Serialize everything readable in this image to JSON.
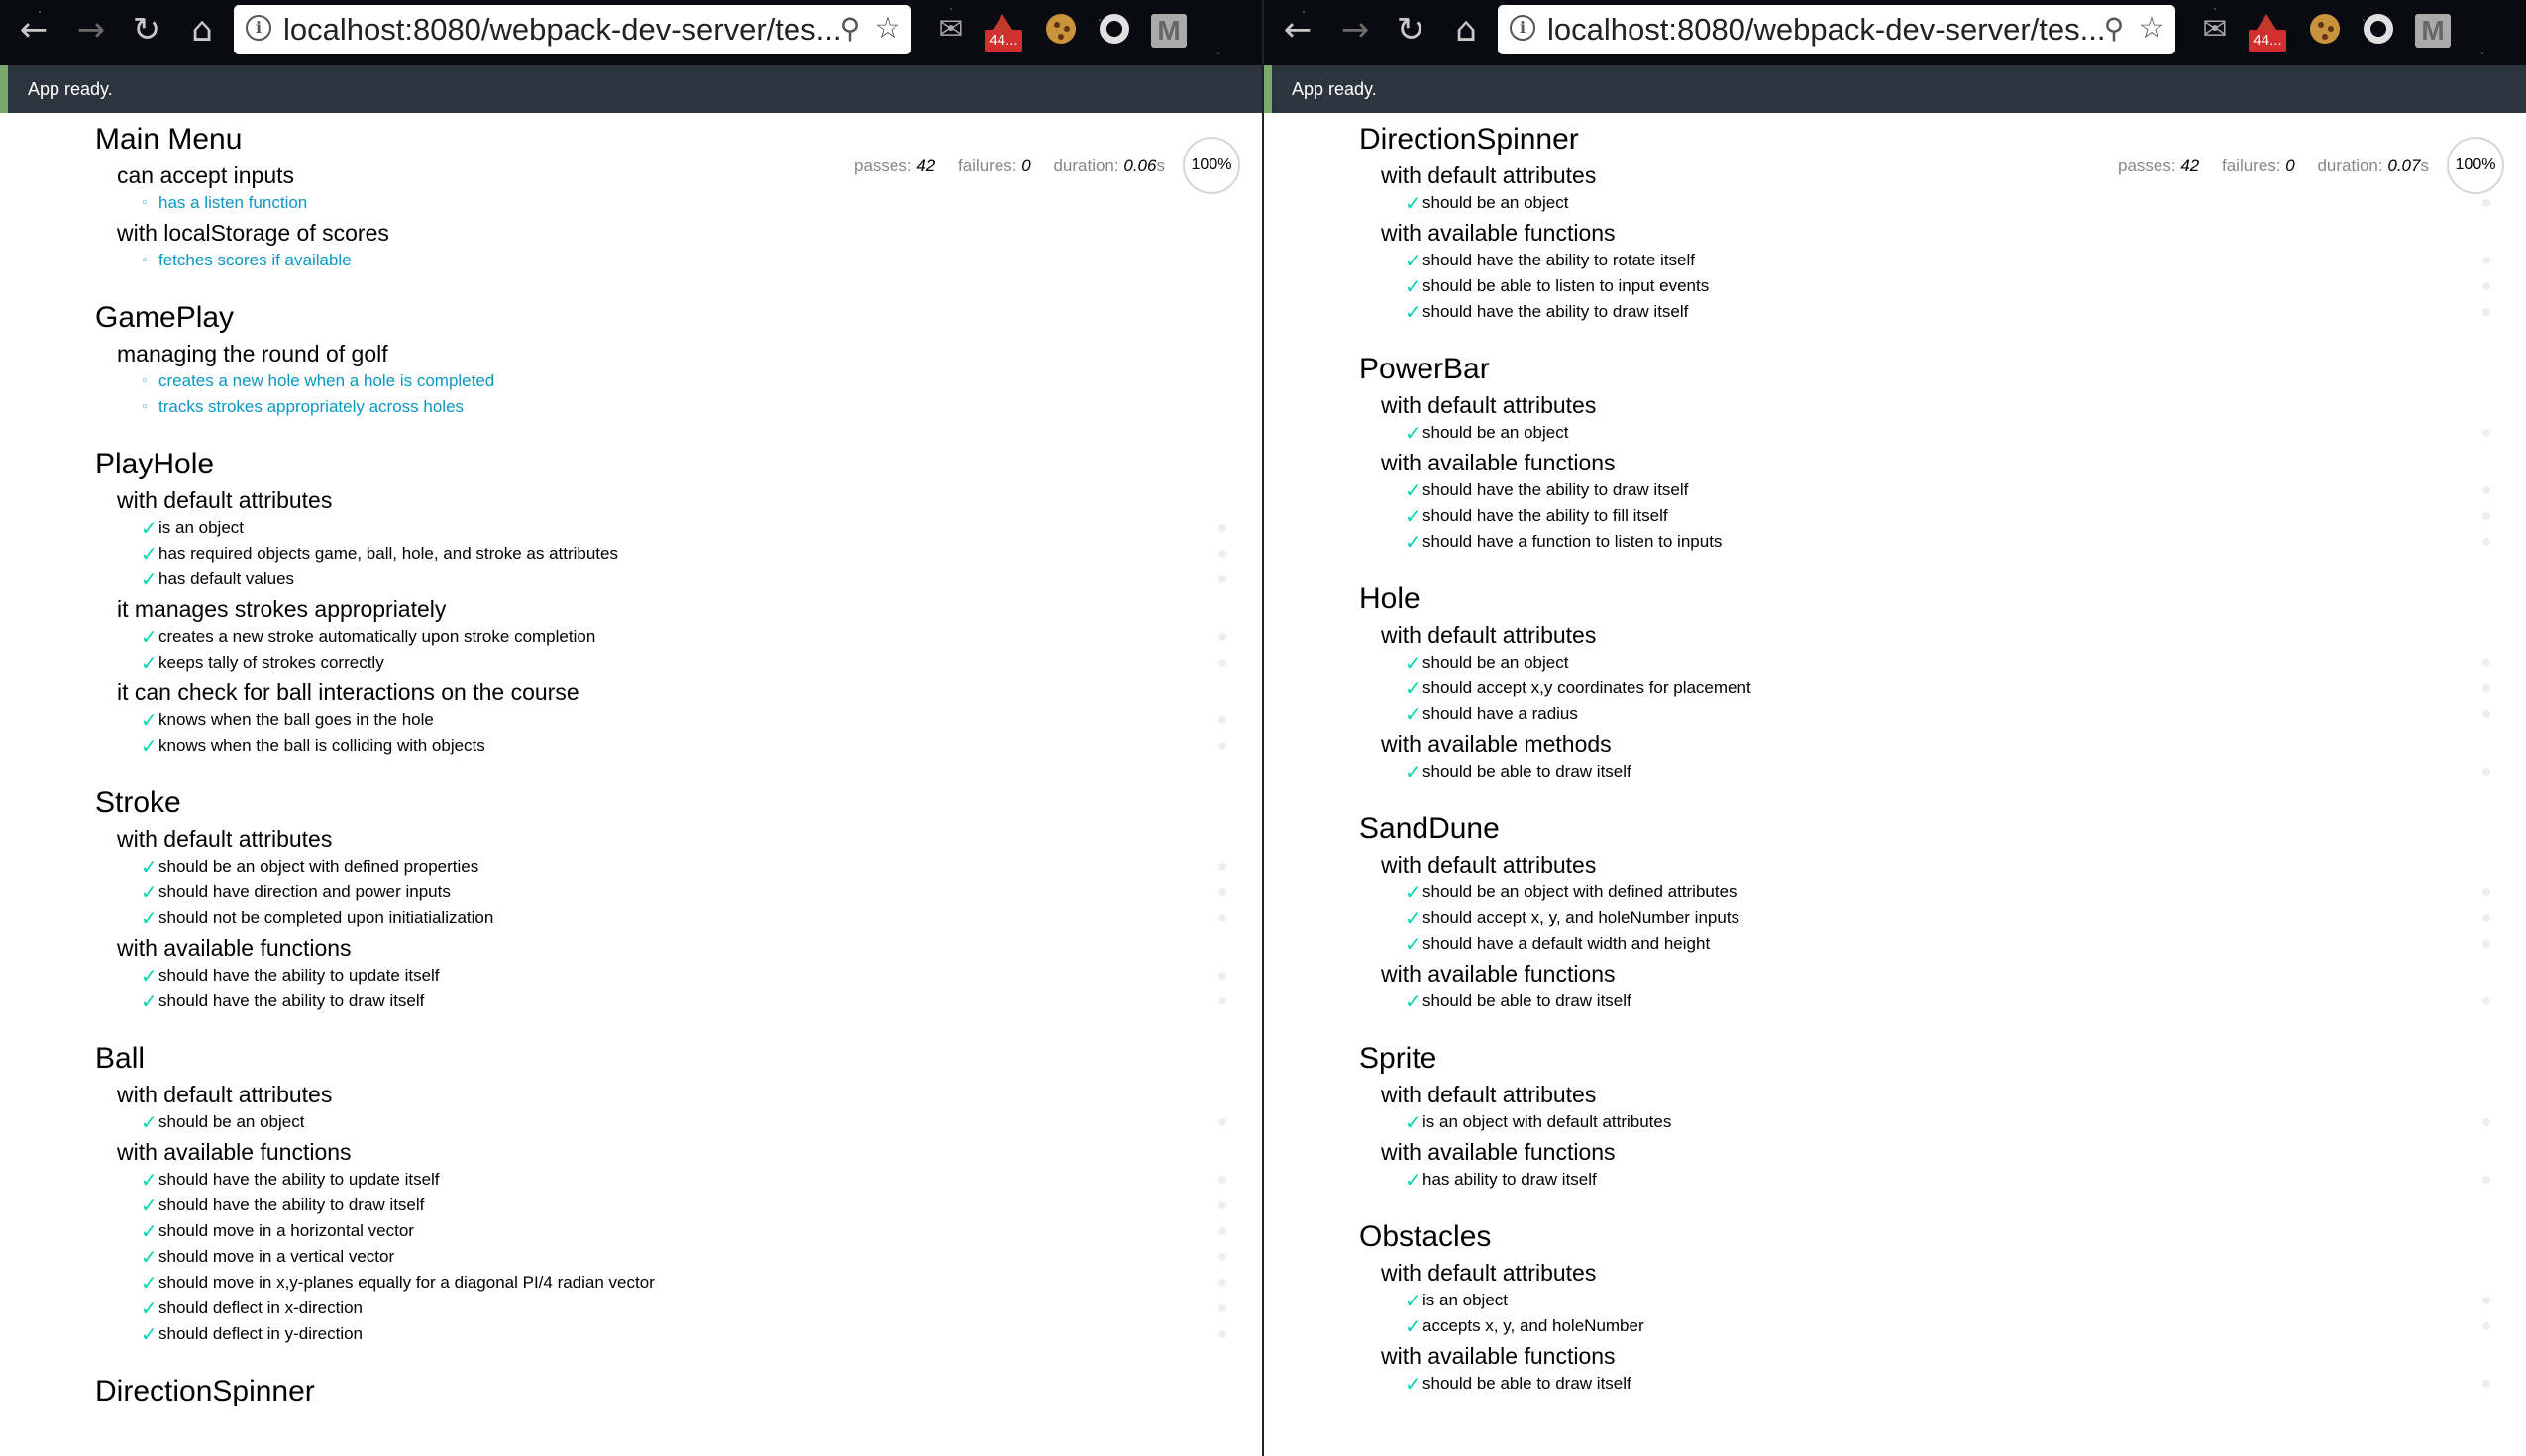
{
  "panes": [
    {
      "url": "localhost:8080/webpack-dev-server/tes...",
      "badge": "44...",
      "status": "App ready.",
      "stats": {
        "passes_label": "passes:",
        "passes": "42",
        "failures_label": "failures:",
        "failures": "0",
        "duration_label": "duration:",
        "duration": "0.06",
        "duration_unit": "s",
        "progress": "100%"
      },
      "suites": [
        {
          "title": "Main Menu",
          "groups": [
            {
              "title": "can accept inputs",
              "tests": [
                {
                  "label": "has a listen function",
                  "state": "pending"
                }
              ]
            },
            {
              "title": "with localStorage of scores",
              "tests": [
                {
                  "label": "fetches scores if available",
                  "state": "pending"
                }
              ]
            }
          ]
        },
        {
          "title": "GamePlay",
          "groups": [
            {
              "title": "managing the round of golf",
              "tests": [
                {
                  "label": "creates a new hole when a hole is completed",
                  "state": "pending"
                },
                {
                  "label": "tracks strokes appropriately across holes",
                  "state": "pending"
                }
              ]
            }
          ]
        },
        {
          "title": "PlayHole",
          "groups": [
            {
              "title": "with default attributes",
              "tests": [
                {
                  "label": "is an object",
                  "state": "pass"
                },
                {
                  "label": "has required objects game, ball, hole, and stroke as attributes",
                  "state": "pass"
                },
                {
                  "label": "has default values",
                  "state": "pass"
                }
              ]
            },
            {
              "title": "it manages strokes appropriately",
              "tests": [
                {
                  "label": "creates a new stroke automatically upon stroke completion",
                  "state": "pass"
                },
                {
                  "label": "keeps tally of strokes correctly",
                  "state": "pass"
                }
              ]
            },
            {
              "title": "it can check for ball interactions on the course",
              "tests": [
                {
                  "label": "knows when the ball goes in the hole",
                  "state": "pass"
                },
                {
                  "label": "knows when the ball is colliding with objects",
                  "state": "pass"
                }
              ]
            }
          ]
        },
        {
          "title": "Stroke",
          "groups": [
            {
              "title": "with default attributes",
              "tests": [
                {
                  "label": "should be an object with defined properties",
                  "state": "pass"
                },
                {
                  "label": "should have direction and power inputs",
                  "state": "pass"
                },
                {
                  "label": "should not be completed upon initiatialization",
                  "state": "pass"
                }
              ]
            },
            {
              "title": "with available functions",
              "tests": [
                {
                  "label": "should have the ability to update itself",
                  "state": "pass"
                },
                {
                  "label": "should have the ability to draw itself",
                  "state": "pass"
                }
              ]
            }
          ]
        },
        {
          "title": "Ball",
          "groups": [
            {
              "title": "with default attributes",
              "tests": [
                {
                  "label": "should be an object",
                  "state": "pass"
                }
              ]
            },
            {
              "title": "with available functions",
              "tests": [
                {
                  "label": "should have the ability to update itself",
                  "state": "pass"
                },
                {
                  "label": "should have the ability to draw itself",
                  "state": "pass"
                },
                {
                  "label": "should move in a horizontal vector",
                  "state": "pass"
                },
                {
                  "label": "should move in a vertical vector",
                  "state": "pass"
                },
                {
                  "label": "should move in x,y-planes equally for a diagonal PI/4 radian vector",
                  "state": "pass"
                },
                {
                  "label": "should deflect in x-direction",
                  "state": "pass"
                },
                {
                  "label": "should deflect in y-direction",
                  "state": "pass"
                }
              ]
            }
          ]
        },
        {
          "title": "DirectionSpinner",
          "groups": []
        }
      ]
    },
    {
      "url": "localhost:8080/webpack-dev-server/tes...",
      "badge": "44...",
      "status": "App ready.",
      "stats": {
        "passes_label": "passes:",
        "passes": "42",
        "failures_label": "failures:",
        "failures": "0",
        "duration_label": "duration:",
        "duration": "0.07",
        "duration_unit": "s",
        "progress": "100%"
      },
      "suites": [
        {
          "title": "DirectionSpinner",
          "groups": [
            {
              "title": "with default attributes",
              "tests": [
                {
                  "label": "should be an object",
                  "state": "pass"
                }
              ]
            },
            {
              "title": "with available functions",
              "tests": [
                {
                  "label": "should have the ability to rotate itself",
                  "state": "pass"
                },
                {
                  "label": "should be able to listen to input events",
                  "state": "pass"
                },
                {
                  "label": "should have the ability to draw itself",
                  "state": "pass"
                }
              ]
            }
          ]
        },
        {
          "title": "PowerBar",
          "groups": [
            {
              "title": "with default attributes",
              "tests": [
                {
                  "label": "should be an object",
                  "state": "pass"
                }
              ]
            },
            {
              "title": "with available functions",
              "tests": [
                {
                  "label": "should have the ability to draw itself",
                  "state": "pass"
                },
                {
                  "label": "should have the ability to fill itself",
                  "state": "pass"
                },
                {
                  "label": "should have a function to listen to inputs",
                  "state": "pass"
                }
              ]
            }
          ]
        },
        {
          "title": "Hole",
          "groups": [
            {
              "title": "with default attributes",
              "tests": [
                {
                  "label": "should be an object",
                  "state": "pass"
                },
                {
                  "label": "should accept x,y coordinates for placement",
                  "state": "pass"
                },
                {
                  "label": "should have a radius",
                  "state": "pass"
                }
              ]
            },
            {
              "title": "with available methods",
              "tests": [
                {
                  "label": "should be able to draw itself",
                  "state": "pass"
                }
              ]
            }
          ]
        },
        {
          "title": "SandDune",
          "groups": [
            {
              "title": "with default attributes",
              "tests": [
                {
                  "label": "should be an object with defined attributes",
                  "state": "pass"
                },
                {
                  "label": "should accept x, y, and holeNumber inputs",
                  "state": "pass"
                },
                {
                  "label": "should have a default width and height",
                  "state": "pass"
                }
              ]
            },
            {
              "title": "with available functions",
              "tests": [
                {
                  "label": "should be able to draw itself",
                  "state": "pass"
                }
              ]
            }
          ]
        },
        {
          "title": "Sprite",
          "groups": [
            {
              "title": "with default attributes",
              "tests": [
                {
                  "label": "is an object with default attributes",
                  "state": "pass"
                }
              ]
            },
            {
              "title": "with available functions",
              "tests": [
                {
                  "label": "has ability to draw itself",
                  "state": "pass"
                }
              ]
            }
          ]
        },
        {
          "title": "Obstacles",
          "groups": [
            {
              "title": "with default attributes",
              "tests": [
                {
                  "label": "is an object",
                  "state": "pass"
                },
                {
                  "label": "accepts x, y, and holeNumber",
                  "state": "pass"
                }
              ]
            },
            {
              "title": "with available functions",
              "tests": [
                {
                  "label": "should be able to draw itself",
                  "state": "pass"
                }
              ]
            }
          ]
        }
      ]
    }
  ],
  "icons": {
    "back": "arrow-left-icon",
    "forward": "arrow-right-icon",
    "reload": "reload-icon",
    "home": "home-icon",
    "info": "info-icon",
    "zoom": "zoom-icon",
    "star": "star-icon",
    "ext1": "mail-icon",
    "ext2": "alert-extension-icon",
    "ext3": "cookie-icon",
    "ext4": "ring-icon",
    "ext5": "m-extension-icon"
  },
  "colors": {
    "pass": "#00d6b2",
    "pending": "#0b97c4",
    "statusbar": "#2c353e",
    "status_accent": "#7aa96b"
  }
}
